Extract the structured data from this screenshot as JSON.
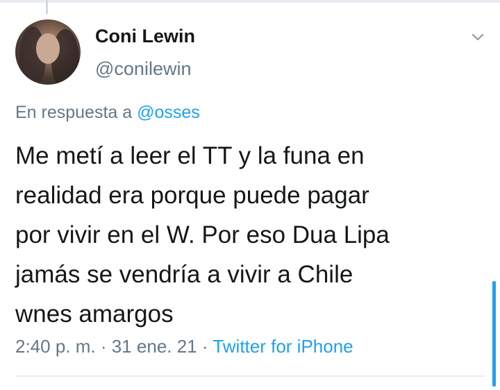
{
  "tweet": {
    "author_name": "Coni Lewin",
    "author_handle": "@conilewin",
    "reply_prefix": "En respuesta a",
    "reply_mention": "@osses",
    "text_lines": [
      "Me metí a leer el TT y la funa en",
      "realidad era porque puede pagar",
      "por vivir en el W. Por eso Dua Lipa",
      "jamás se vendría a vivir a Chile",
      "wnes amargos"
    ],
    "time": "2:40 p. m.",
    "separator": "·",
    "date": "31 ene. 21",
    "source": "Twitter for iPhone"
  },
  "icons": {
    "menu": "chevron-down-icon"
  },
  "colors": {
    "accent": "#1da1f2",
    "secondary_text": "#657786",
    "primary_text": "#14171a"
  }
}
